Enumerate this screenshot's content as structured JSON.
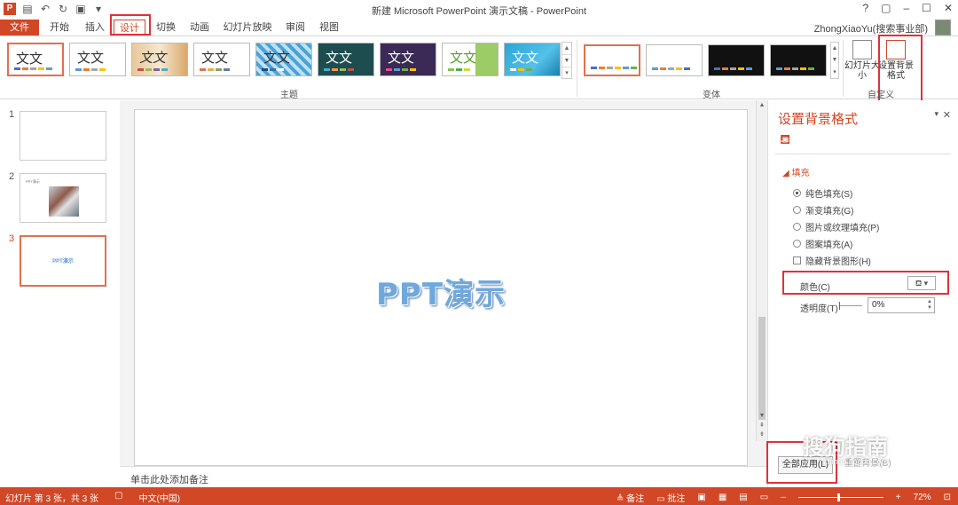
{
  "window": {
    "title": "新建 Microsoft PowerPoint 演示文稿 - PowerPoint",
    "controls": [
      "?",
      "▢",
      "–",
      "☐",
      "✕"
    ]
  },
  "quick_access": {
    "app_icon": "P",
    "icons": [
      "save-icon",
      "undo-icon",
      "redo-icon",
      "start-from-beginning-icon",
      "customize-icon"
    ]
  },
  "ribbon_tabs": [
    "文件",
    "开始",
    "插入",
    "设计",
    "切换",
    "动画",
    "幻灯片放映",
    "审阅",
    "视图"
  ],
  "active_tab": "设计",
  "user": {
    "name": "ZhongXiaoYu(搜索事业部)"
  },
  "ribbon": {
    "themes_group_label": "主题",
    "theme_text": "文文",
    "variants_group_label": "变体",
    "customize_group_label": "自定义",
    "slide_size_label": "幻灯片大小",
    "format_bg_label": "设置背景格式"
  },
  "slides": [
    {
      "number": "1",
      "title": ""
    },
    {
      "number": "2",
      "title": "PPT演示"
    },
    {
      "number": "3",
      "title": "PPT演示"
    }
  ],
  "current_slide": {
    "title": "PPT演示"
  },
  "notes_placeholder": "单击此处添加备注",
  "format_pane": {
    "title": "设置背景格式",
    "section": "填充",
    "options": [
      {
        "label": "纯色填充(S)",
        "selected": true
      },
      {
        "label": "渐变填充(G)",
        "selected": false
      },
      {
        "label": "图片或纹理填充(P)",
        "selected": false
      },
      {
        "label": "图案填充(A)",
        "selected": false
      }
    ],
    "hide_bg_label": "隐藏背景图形(H)",
    "color_label": "颜色(C)",
    "transparency_label": "透明度(T)",
    "transparency_value": "0%",
    "apply_all_label": "全部应用(L)",
    "reset_label": "重置背景(B)"
  },
  "status": {
    "slide_info": "幻灯片 第 3 张，共 3 张",
    "language": "中文(中国)",
    "notes": "备注",
    "comments": "批注",
    "zoom": "72%"
  },
  "watermark": {
    "main": "搜狗指南",
    "sub": "zhinan.sogou.com"
  },
  "colors": {
    "accent": "#d24726",
    "highlight": "#e0313b",
    "title_blue": "#6fa8dc"
  }
}
